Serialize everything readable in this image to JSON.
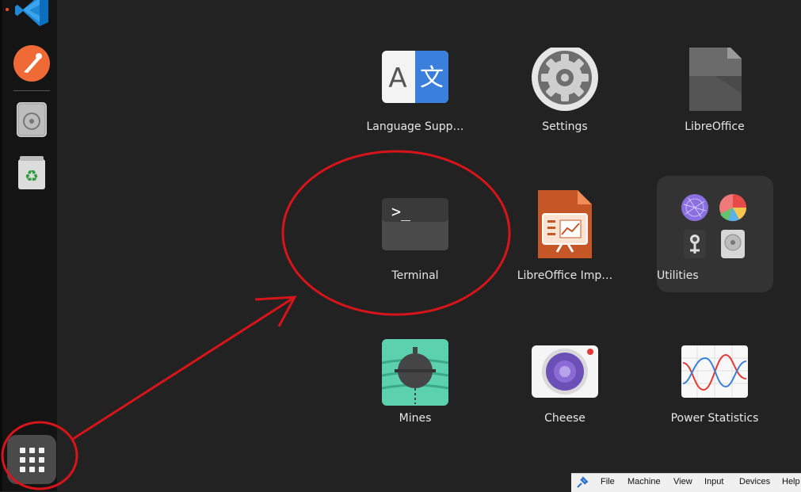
{
  "dock": {
    "items": [
      {
        "name": "vscode-icon"
      },
      {
        "name": "postman-icon"
      },
      {
        "name": "disc-icon"
      },
      {
        "name": "trash-icon"
      }
    ],
    "show_apps": "show-applications-grid-icon"
  },
  "apps": {
    "language_support": "Language Supp…",
    "settings": "Settings",
    "libreoffice": "LibreOffice",
    "terminal": "Terminal",
    "libreoffice_impress": "LibreOffice Imp…",
    "utilities": "Utilities",
    "mines": "Mines",
    "cheese": "Cheese",
    "power_statistics": "Power Statistics",
    "language_glyph_a": "A",
    "language_glyph_b": "文",
    "terminal_prompt": ">_"
  },
  "status_bar": {
    "menus": [
      "File",
      "Machine",
      "View",
      "Input",
      "Devices",
      "Help"
    ]
  },
  "annotations": {
    "color": "#d6141a"
  }
}
